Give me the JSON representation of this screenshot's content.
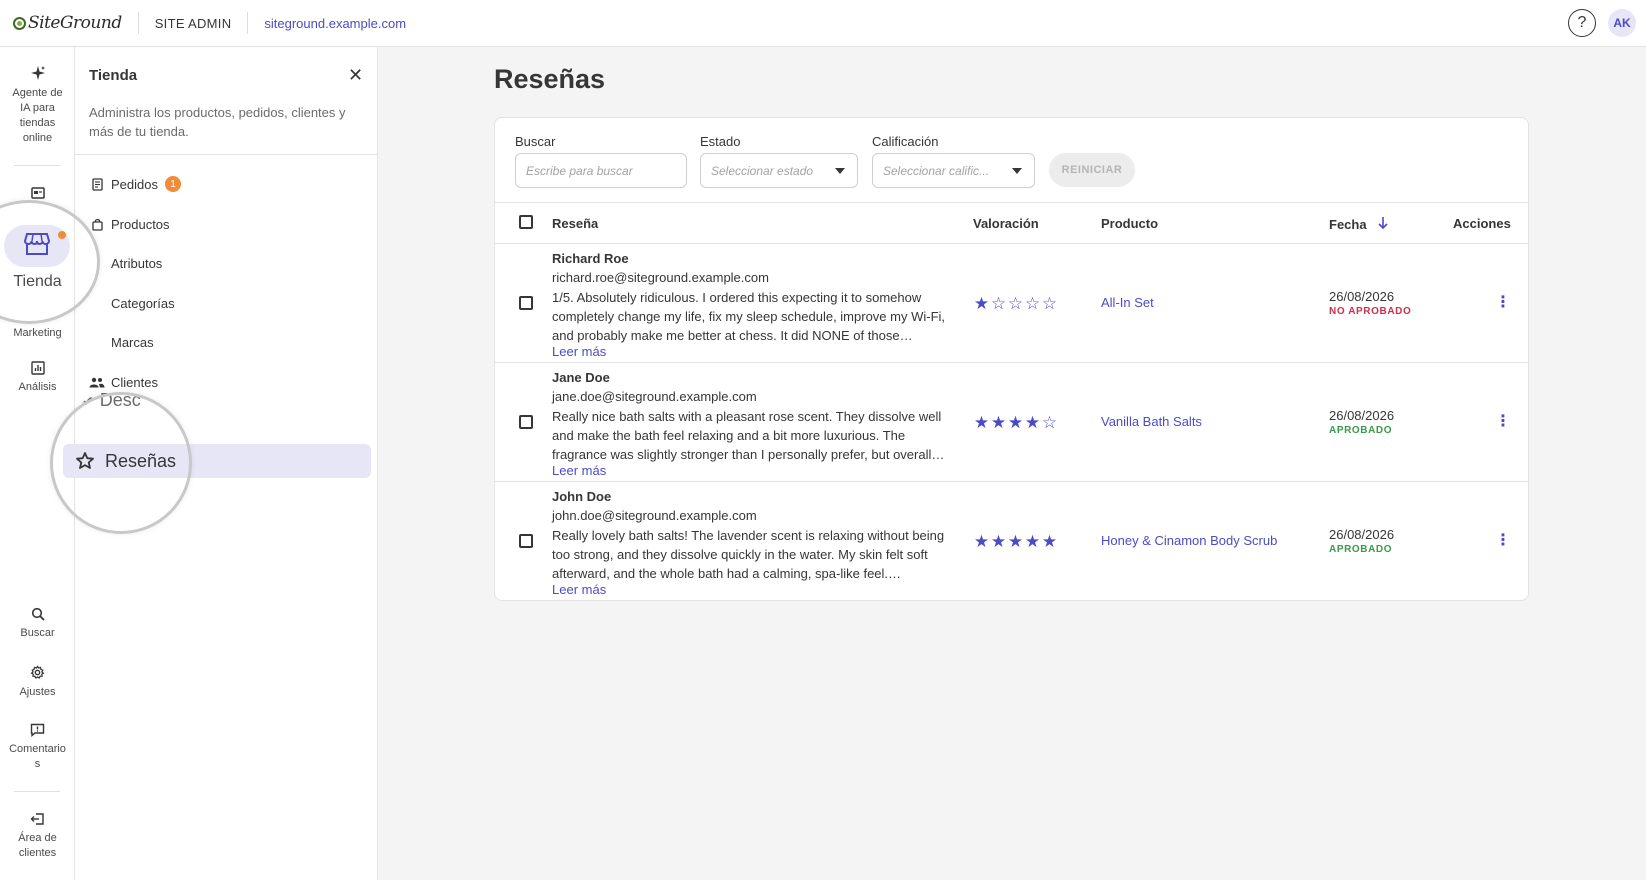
{
  "topbar": {
    "logo": "SiteGround",
    "site_admin": "SITE ADMIN",
    "site_url": "siteground.example.com",
    "help": "?",
    "avatar": "AK"
  },
  "rail": {
    "items": [
      {
        "label": "Agente de IA para tiendas online",
        "icon": "sparkle-icon"
      },
      {
        "label": "",
        "icon": "dashboard-icon"
      },
      {
        "label": "Tienda",
        "icon": "store-icon"
      },
      {
        "label": "Marketing",
        "icon": "megaphone-icon"
      },
      {
        "label": "Análisis",
        "icon": "chart-icon"
      },
      {
        "label": "Buscar",
        "icon": "search-icon"
      },
      {
        "label": "Ajustes",
        "icon": "gear-icon"
      },
      {
        "label": "Comentarios",
        "icon": "comment-icon"
      },
      {
        "label": "Área de clientes",
        "icon": "logout-icon"
      }
    ]
  },
  "panel": {
    "title": "Tienda",
    "description": "Administra los productos, pedidos, clientes y más de tu tienda.",
    "items": [
      {
        "label": "Pedidos",
        "badge": "1"
      },
      {
        "label": "Productos"
      },
      {
        "label": "Atributos"
      },
      {
        "label": "Categorías"
      },
      {
        "label": "Marcas"
      },
      {
        "label": "Clientes"
      },
      {
        "label": "Desc"
      },
      {
        "label": "Reseñas"
      }
    ]
  },
  "main": {
    "title": "Reseñas",
    "filters": {
      "search_label": "Buscar",
      "search_placeholder": "Escribe para buscar",
      "status_label": "Estado",
      "status_placeholder": "Seleccionar estado",
      "rating_label": "Calificación",
      "rating_placeholder": "Seleccionar calific...",
      "reset": "REINICIAR"
    },
    "columns": [
      "Reseña",
      "Valoración",
      "Producto",
      "Fecha",
      "Acciones"
    ],
    "rows": [
      {
        "name": "Richard Roe",
        "email": "richard.roe@siteground.example.com",
        "text": "1/5. Absolutely ridiculous. I ordered this expecting it to somehow completely change my life, fix my sleep schedule, improve my Wi-Fi, and probably make me better at chess. It did NONE of those things....",
        "more": "Leer más",
        "rating": 1,
        "product": "All-In Set",
        "date": "26/08/2026",
        "status": "NO APROBADO",
        "status_color": "#c8304d"
      },
      {
        "name": "Jane Doe",
        "email": "jane.doe@siteground.example.com",
        "text": "Really nice bath salts with a pleasant rose scent. They dissolve well and make the bath feel relaxing and a bit more luxurious. The fragrance was slightly stronger than I personally prefer, but overall I...",
        "more": "Leer más",
        "rating": 4,
        "product": "Vanilla Bath Salts",
        "date": "26/08/2026",
        "status": "APROBADO",
        "status_color": "#3a9a4a"
      },
      {
        "name": "John Doe",
        "email": "john.doe@siteground.example.com",
        "text": "Really lovely bath salts! The lavender scent is relaxing without being too strong, and they dissolve quickly in the water. My skin felt soft afterward, and the whole bath had a calming, spa-like feel. Definitel...",
        "more": "Leer más",
        "rating": 5,
        "product": "Honey & Cinamon Body Scrub",
        "date": "26/08/2026",
        "status": "APROBADO",
        "status_color": "#3a9a4a"
      }
    ]
  },
  "colors": {
    "accent": "#4b4bc8",
    "active_bg": "#e6e6f7",
    "badge": "#f08c38"
  }
}
